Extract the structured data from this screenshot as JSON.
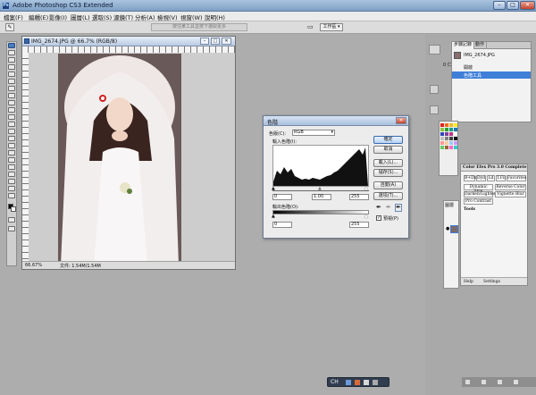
{
  "app": {
    "title": "Adobe Photoshop CS3 Extended"
  },
  "window_controls": {
    "min": "–",
    "max": "□",
    "close": "✕"
  },
  "menu": [
    "檔案(F)",
    "編輯(E)",
    "影像(I)",
    "圖層(L)",
    "選取(S)",
    "濾鏡(T)",
    "分析(A)",
    "檢視(V)",
    "視窗(W)",
    "說明(H)"
  ],
  "options_bar": {
    "hint": "按住某工具並按下選取更多",
    "workspace_label": "工作區 ▾"
  },
  "document": {
    "title": "IMG_2674.JPG @ 66.7% (RGB/8)",
    "zoom": "66.67%",
    "doc_size": "文件: 1.54M/1.54M"
  },
  "levels_dialog": {
    "title": "色階",
    "channel_label": "色版(C):",
    "channel_value": "RGB",
    "input_label": "輸入色階(I):",
    "output_label": "輸出色階(O):",
    "input_values": [
      "0",
      "1.00",
      "255"
    ],
    "output_values": [
      "0",
      "255"
    ],
    "buttons": [
      "確定",
      "取消",
      "載入(L)...",
      "儲存(S)...",
      "自動(A)",
      "選項(T)..."
    ],
    "preview_label": "預視(P)",
    "preview_checked": true
  },
  "history_panel": {
    "tabs": [
      "步驟記錄",
      "動作"
    ],
    "snapshot": "IMG_2674.JPG",
    "items": [
      "開啟",
      "色階",
      "色階工具"
    ],
    "selected_index": 2
  },
  "swatch_colors": [
    "#e32222",
    "#f06b1e",
    "#f5b91c",
    "#ffec1f",
    "#8cc63f",
    "#2ca02c",
    "#16a085",
    "#1f77b4",
    "#3046b8",
    "#7b3fa0",
    "#c13584",
    "#ffffff",
    "#c0c0c0",
    "#808080",
    "#404040",
    "#000000",
    "#ff9999",
    "#ffcc99",
    "#99ccff",
    "#cc99ff",
    "#66cc66",
    "#996633",
    "#ff66cc",
    "#33cccc"
  ],
  "color_efex": {
    "title": "Color Efex Pro 3.0 Complete",
    "tabs": [
      "B+Dx",
      "Dyd",
      "Ld",
      "T.Fil",
      "Favorites"
    ],
    "filters": [
      [
        "Dynamic Skin",
        "Reverse Color"
      ],
      [
        "Darken/Lighten",
        "Vignette Blur"
      ],
      [
        "Pro Contrast",
        ""
      ]
    ],
    "tools_label": "Tools",
    "footer": [
      "Help",
      "Settings"
    ]
  },
  "layers_panel": {
    "tab": "圖層"
  },
  "side_labels": [
    "0 仁",
    "文件"
  ],
  "taskbar": {
    "lang": "CH"
  }
}
